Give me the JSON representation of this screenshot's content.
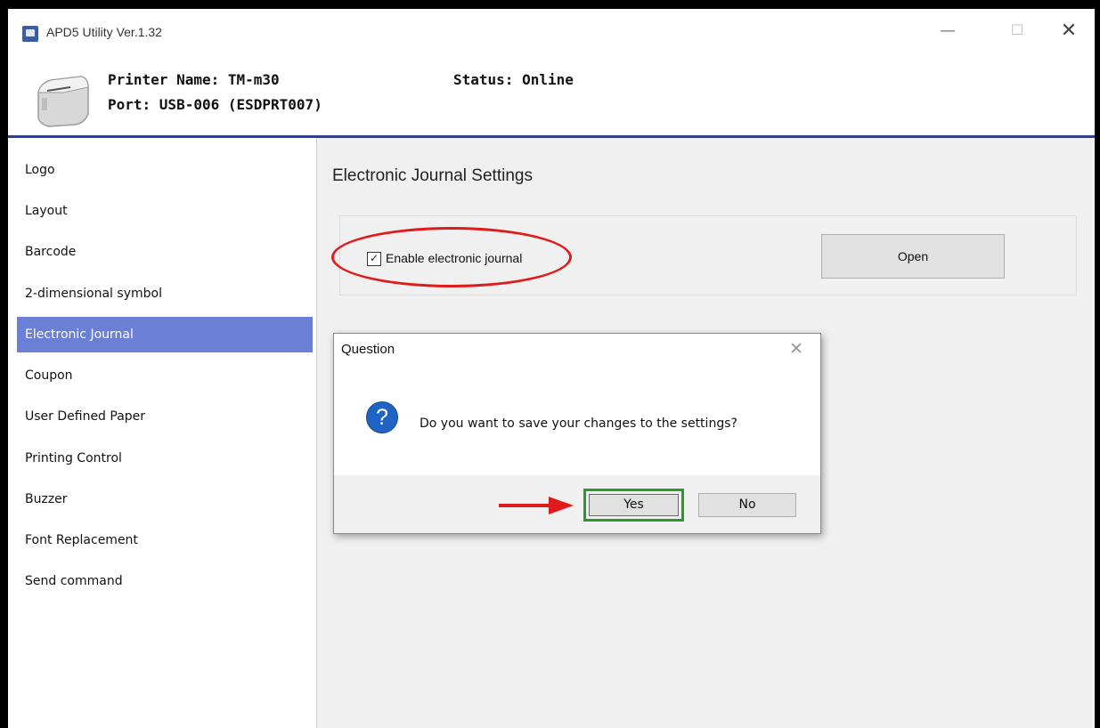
{
  "window": {
    "title": "APD5 Utility Ver.1.32",
    "controls": {
      "minimize": "—",
      "maximize": "☐",
      "close": "✕"
    }
  },
  "header": {
    "printer_name": "Printer Name: TM-m30",
    "port": "Port: USB-006 (ESDPRT007)",
    "status": "Status: Online",
    "accent_color": "#2f3d8a"
  },
  "sidebar": {
    "selected_index": 4,
    "items": [
      {
        "label": "Logo"
      },
      {
        "label": "Layout"
      },
      {
        "label": "Barcode"
      },
      {
        "label": "2-dimensional symbol"
      },
      {
        "label": "Electronic Journal"
      },
      {
        "label": "Coupon"
      },
      {
        "label": "User Defined Paper"
      },
      {
        "label": "Printing Control"
      },
      {
        "label": "Buzzer"
      },
      {
        "label": "Font Replacement"
      },
      {
        "label": "Send command"
      }
    ],
    "selected_color": "#6b7fd7"
  },
  "main": {
    "title": "Electronic Journal Settings",
    "enable_checkbox": {
      "label": "Enable electronic journal",
      "checked": true,
      "glyph": "✓"
    },
    "open_button": "Open"
  },
  "dialog": {
    "title": "Question",
    "close_glyph": "✕",
    "icon": "question-icon",
    "icon_glyph": "?",
    "message": "Do you want to save your changes to the settings?",
    "yes_label": "Yes",
    "no_label": "No"
  },
  "annotations": {
    "ellipse_color": "#e01b1b",
    "arrow_color": "#e01b1b",
    "highlight_color": "#2b9a2b"
  }
}
